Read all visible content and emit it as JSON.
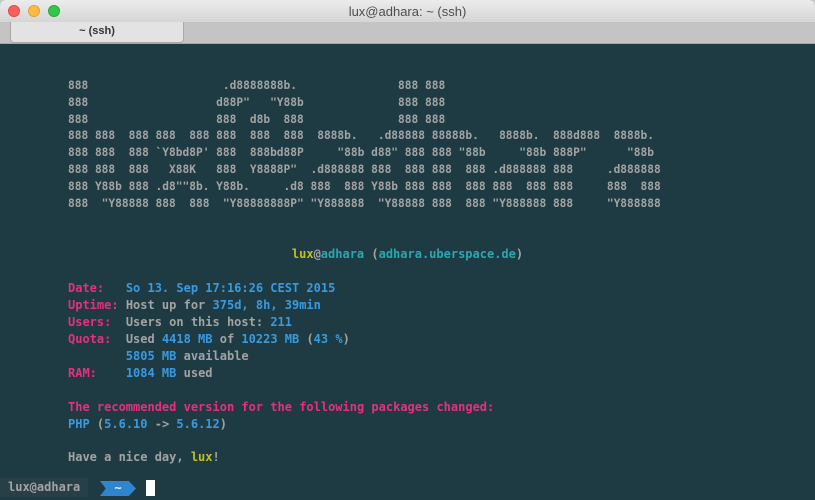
{
  "window": {
    "title": "lux@adhara: ~ (ssh)"
  },
  "tab": {
    "label": "~ (ssh)"
  },
  "banner": "888                    .d8888888b.               888 888\n888                   d88P\"   \"Y88b              888 888\n888                   888  d8b  888              888 888\n888 888  888 888  888 888  888  888  8888b.   .d88888 88888b.   8888b.  888d888  8888b.\n888 888  888 `Y8bd8P' 888  888bd88P     \"88b d88\" 888 888 \"88b     \"88b 888P\"      \"88b\n888 888  888   X88K   888  Y8888P\"  .d888888 888  888 888  888 .d888888 888     .d888888\n888 Y88b 888 .d8\"\"8b. Y88b.     .d8 888  888 Y88b 888 888  888 888  888 888     888  888\n888  \"Y88888 888  888  \"Y88888888P\" \"Y888888  \"Y88888 888  888 \"Y888888 888     \"Y888888",
  "host": {
    "user": "lux",
    "at": "@",
    "host": "adhara",
    "open": " (",
    "domain": "adhara.uberspace.de",
    "close": ")"
  },
  "info": {
    "date": {
      "label": "Date:",
      "value": "So 13. Sep 17:16:26 CEST 2015"
    },
    "uptime": {
      "label": "Uptime:",
      "prefix": "Host up for ",
      "value": "375d, 8h, 39min"
    },
    "users": {
      "label": "Users:",
      "prefix": "Users on this host: ",
      "value": "211"
    },
    "quota": {
      "label": "Quota:",
      "used_word": "Used ",
      "used": "4418 MB",
      "of": " of ",
      "total": "10223 MB",
      "open": " (",
      "percent": "43 %",
      "close": ")",
      "available": "5805 MB",
      "available_word": " available"
    },
    "ram": {
      "label": "RAM:",
      "value": "1084 MB",
      "suffix": " used"
    }
  },
  "packages": {
    "heading": "The recommended version for the following packages changed:",
    "name": "PHP ",
    "open": "(",
    "old": "5.6.10",
    "arrow": " -> ",
    "new": "5.6.12",
    "close": ")"
  },
  "farewell": {
    "text": "Have a nice day, ",
    "user": "lux",
    "bang": "!"
  },
  "prompt": {
    "user_host": "lux@adhara",
    "dir": "~"
  }
}
